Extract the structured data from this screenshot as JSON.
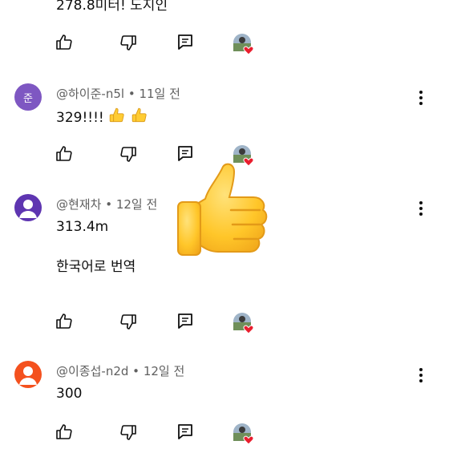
{
  "partial_comment": {
    "text": "278.8미터! 도지인"
  },
  "comments": [
    {
      "author": "@하이준-n5l",
      "time": "11일 전",
      "avatar_initial": "준",
      "text": "329!!!!",
      "emoji_count": 2
    },
    {
      "author": "@현재차",
      "time": "12일 전",
      "text": "313.4m",
      "translate_label": "한국어로 번역"
    },
    {
      "author": "@이종섭-n2d",
      "time": "12일 전",
      "text": "300"
    }
  ],
  "icons": {
    "like": "thumbs-up-outline-icon",
    "dislike": "thumbs-down-outline-icon",
    "reply": "reply-comment-icon",
    "more": "more-vertical-icon",
    "creator_heart": "creator-heart-badge",
    "emoji": "thumbs-up-emoji"
  },
  "colors": {
    "text": "#0f0f0f",
    "meta": "#606060",
    "heart": "#e91e2e",
    "emoji": "#ffcc33"
  }
}
